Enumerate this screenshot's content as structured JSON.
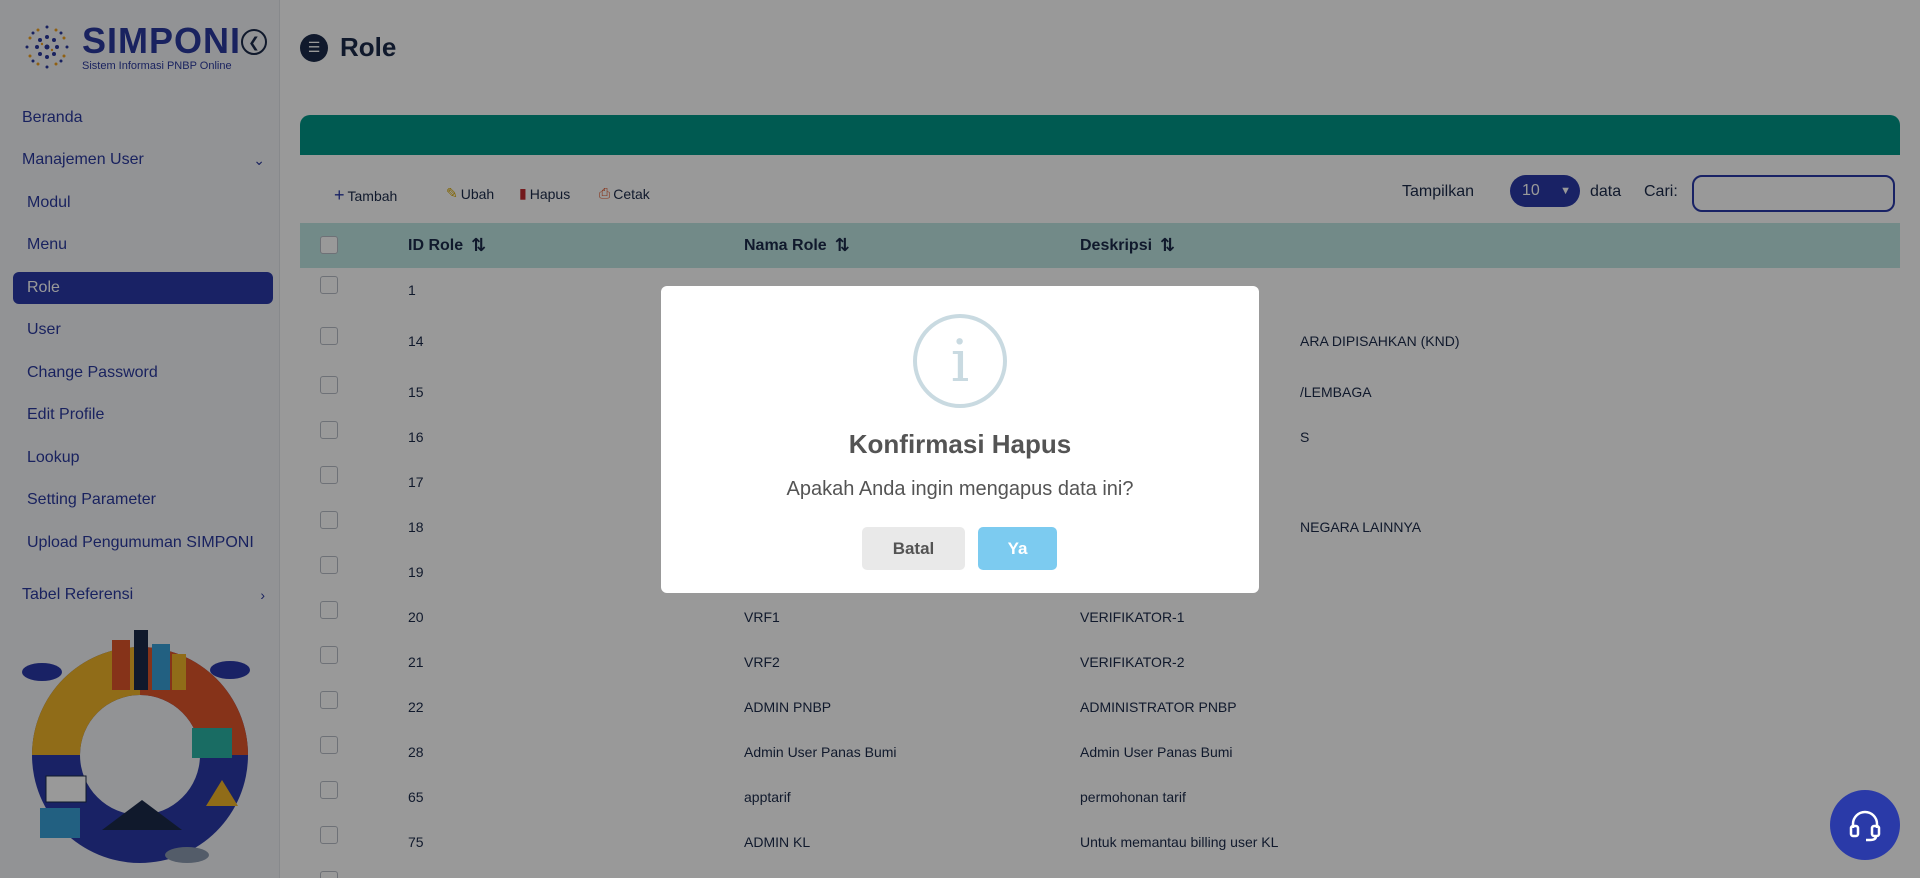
{
  "brand": {
    "name": "SIMPONI",
    "subtitle": "Sistem Informasi PNBP Online"
  },
  "sidebar": {
    "items": [
      {
        "label": "Beranda"
      },
      {
        "label": "Manajemen User"
      },
      {
        "label": "Modul"
      },
      {
        "label": "Menu"
      },
      {
        "label": "Role",
        "active": true
      },
      {
        "label": "User"
      },
      {
        "label": "Change Password"
      },
      {
        "label": "Edit Profile"
      },
      {
        "label": "Lookup"
      },
      {
        "label": "Setting Parameter"
      },
      {
        "label": "Upload Pengumuman SIMPONI"
      },
      {
        "label": "Tabel Referensi"
      }
    ]
  },
  "page": {
    "title": "Role"
  },
  "toolbar": {
    "add_label": "Tambah",
    "edit_label": "Ubah",
    "delete_label": "Hapus",
    "print_label": "Cetak",
    "show_label": "Tampilkan",
    "page_size": "10",
    "data_label": "data",
    "search_label": "Cari:",
    "search_value": ""
  },
  "table": {
    "headers": [
      "ID Role",
      "Nama Role",
      "Deskripsi"
    ],
    "rows": [
      {
        "id": "1",
        "name": "",
        "desc": ""
      },
      {
        "id": "14",
        "name": "",
        "desc": "ARA DIPISAHKAN (KND)"
      },
      {
        "id": "15",
        "name": "",
        "desc": "/LEMBAGA"
      },
      {
        "id": "16",
        "name": "",
        "desc": "S"
      },
      {
        "id": "17",
        "name": "",
        "desc": ""
      },
      {
        "id": "18",
        "name": "",
        "desc": "NEGARA LAINNYA"
      },
      {
        "id": "19",
        "name": "",
        "desc": ""
      },
      {
        "id": "20",
        "name": "VRF1",
        "desc": "VERIFIKATOR-1"
      },
      {
        "id": "21",
        "name": "VRF2",
        "desc": "VERIFIKATOR-2"
      },
      {
        "id": "22",
        "name": "ADMIN PNBP",
        "desc": "ADMINISTRATOR PNBP"
      },
      {
        "id": "28",
        "name": "Admin User Panas Bumi",
        "desc": "Admin User Panas Bumi"
      },
      {
        "id": "65",
        "name": "apptarif",
        "desc": "permohonan tarif"
      },
      {
        "id": "75",
        "name": "ADMIN KL",
        "desc": "Untuk memantau billing user KL"
      }
    ]
  },
  "modal": {
    "title": "Konfirmasi Hapus",
    "message": "Apakah Anda ingin mengapus data ini?",
    "cancel_label": "Batal",
    "confirm_label": "Ya"
  },
  "colors": {
    "primary": "#2a3aa8",
    "teal": "#009688",
    "table_head": "#bfe7e3",
    "confirm": "#7ccbf0"
  }
}
